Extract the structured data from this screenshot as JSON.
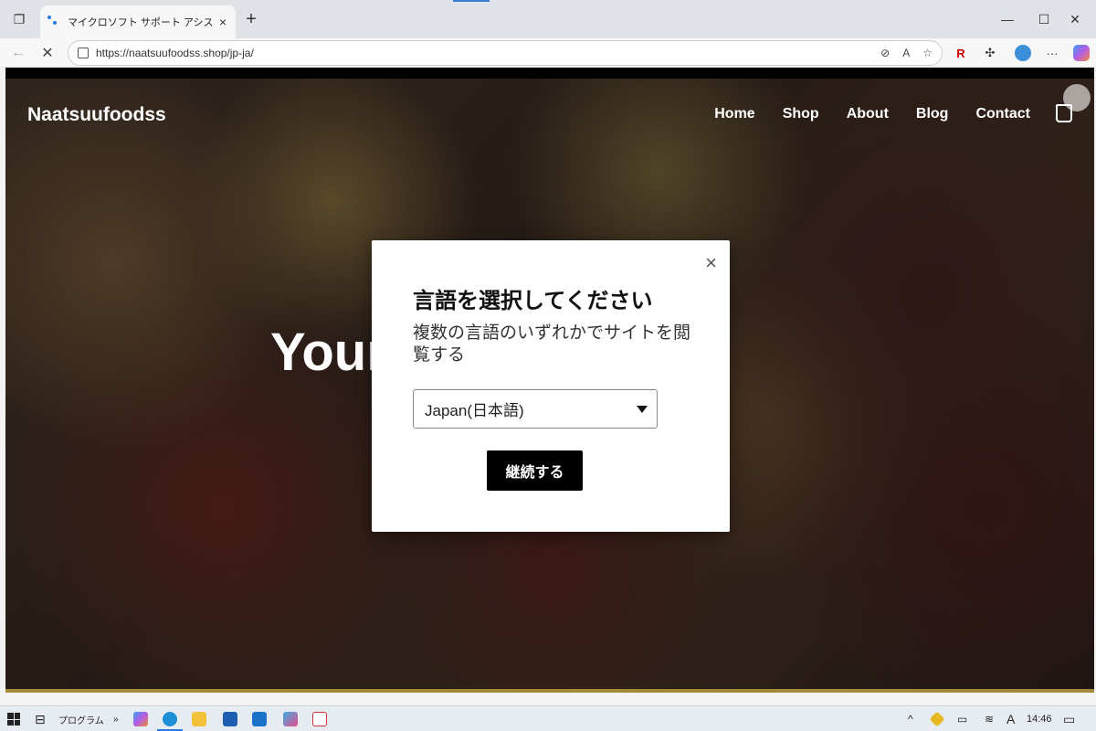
{
  "browser": {
    "tab_title": "マイクロソフト サポート アシスタンス cor",
    "url": "https://naatsuufoodss.shop/jp-ja/",
    "tab_close": "×",
    "new_tab": "+",
    "minimize": "—",
    "maximize": "☐",
    "close": "✕",
    "back": "←",
    "reload": "✕",
    "reader": "A",
    "ext_r": "R",
    "more": "···"
  },
  "site": {
    "brand": "Naatsuufoodss",
    "nav": [
      "Home",
      "Shop",
      "About",
      "Blog",
      "Contact"
    ],
    "headline": "Your ... nese"
  },
  "modal": {
    "close": "×",
    "title": "言語を選択してください",
    "description": "複数の言語のいずれかでサイトを閲覧する",
    "select_value": "Japan(日本語)",
    "continue": "継続する"
  },
  "taskbar": {
    "programs": "プログラム",
    "chevron": "»",
    "time": "14:46",
    "ime": "A",
    "up": "^"
  },
  "colors": {
    "accent": "#2a7ae2",
    "modal_button": "#000000"
  }
}
